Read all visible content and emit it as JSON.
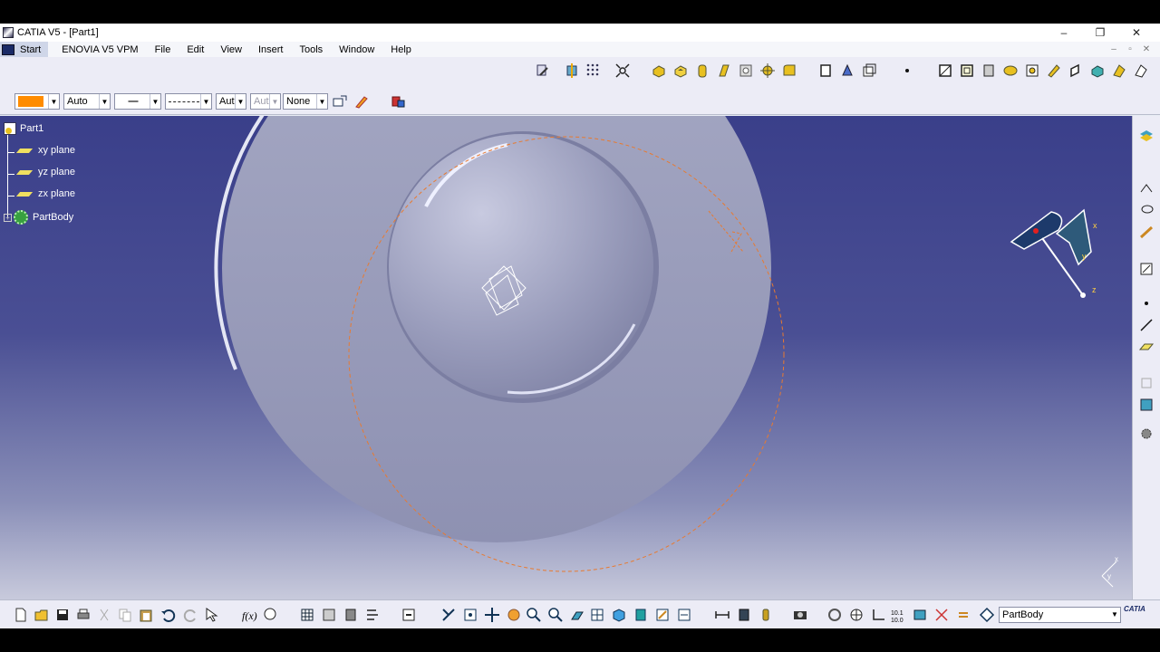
{
  "window": {
    "title": "CATIA V5 - [Part1]",
    "controls": [
      "–",
      "❐",
      "✕"
    ]
  },
  "menu": {
    "start": "Start",
    "items": [
      "ENOVIA V5 VPM",
      "File",
      "Edit",
      "View",
      "Insert",
      "Tools",
      "Window",
      "Help"
    ],
    "doc_controls": [
      "–",
      "▫",
      "✕"
    ]
  },
  "graphic_properties": {
    "color_value": "",
    "color": "#ff8c00",
    "transparency": "Auto",
    "linetype": "—",
    "thickness": "Aut",
    "thickness2": "Aut",
    "layer": "None"
  },
  "spec_tree": {
    "root": "Part1",
    "items": [
      "xy plane",
      "yz plane",
      "zx plane",
      "PartBody"
    ]
  },
  "compass": {
    "x_label": "x",
    "y_label": "y",
    "z_label": "z"
  },
  "axis_label": {
    "x": "x",
    "y": "y"
  },
  "bottom": {
    "current_body": "PartBody",
    "logo": "CATIA"
  },
  "colors": {
    "accent": "#ff8c00",
    "viewport_bg": "#3a3f8a",
    "part": "#a9acc6"
  }
}
